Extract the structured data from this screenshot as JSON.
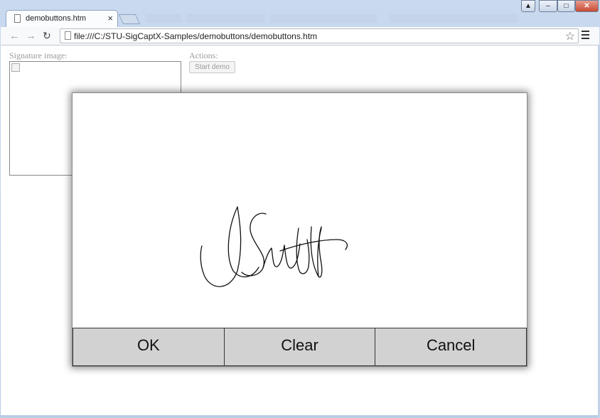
{
  "browser": {
    "tab_title": "demobuttons.htm",
    "tab_close": "×",
    "url": "file:///C:/STU-SigCaptX-Samples/demobuttons/demobuttons.htm",
    "back_glyph": "←",
    "forward_glyph": "→",
    "reload_glyph": "↻",
    "star_glyph": "☆",
    "window_controls": {
      "minimize": "–",
      "maximize": "□",
      "close": "✕",
      "user": "▲"
    }
  },
  "page": {
    "signature_label": "Signature image:",
    "actions_label": "Actions:",
    "start_demo_label": "Start demo"
  },
  "dialog": {
    "ok_label": "OK",
    "clear_label": "Clear",
    "cancel_label": "Cancel"
  },
  "icons": [
    "page-icon",
    "back-arrow-icon",
    "forward-arrow-icon",
    "reload-icon",
    "bookmark-star-icon",
    "menu-icon",
    "broken-image-icon"
  ]
}
